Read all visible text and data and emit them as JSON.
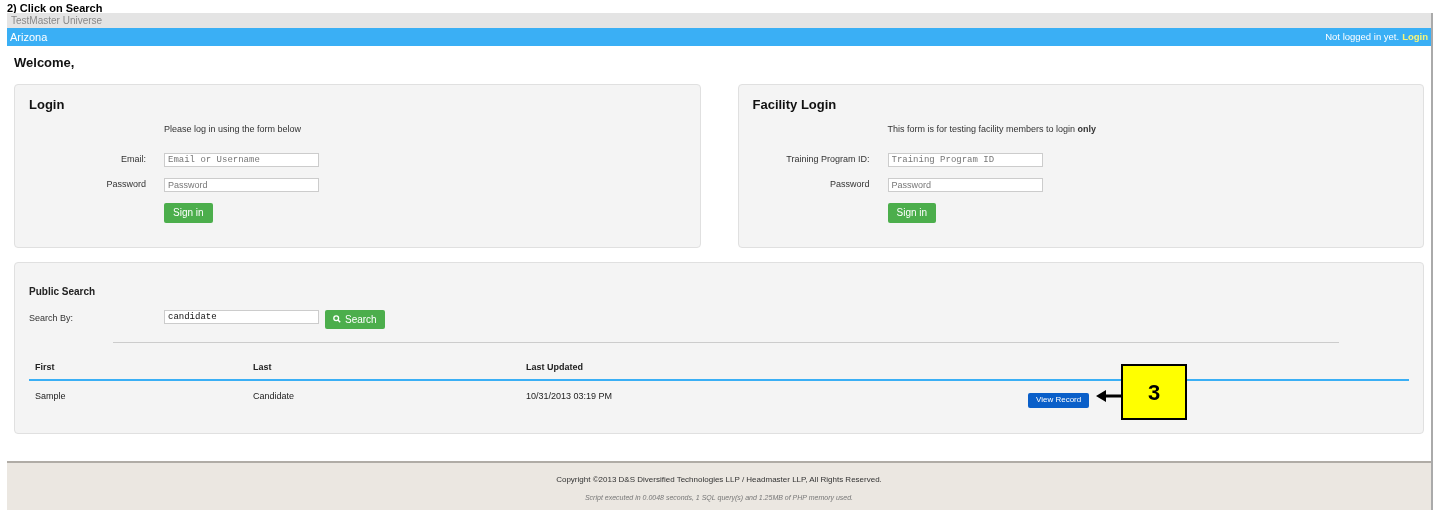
{
  "caption": "2) Click on Search",
  "header": {
    "brand": "TestMaster Universe",
    "state": "Arizona",
    "login_status": "Not logged in yet.",
    "login_link": "Login"
  },
  "welcome": "Welcome,",
  "login": {
    "title": "Login",
    "note": "Please log in using the form below",
    "fields": [
      {
        "label": "Email:",
        "placeholder": "Email or Username",
        "kind": "mono"
      },
      {
        "label": "Password",
        "placeholder": "Password",
        "kind": "sans"
      }
    ],
    "button": "Sign in"
  },
  "facility_login": {
    "title": "Facility Login",
    "note": "This form is for testing facility members to login **only**",
    "fields": [
      {
        "label": "Training Program ID:",
        "placeholder": "Training Program ID",
        "kind": "mono"
      },
      {
        "label": "Password",
        "placeholder": "Password",
        "kind": "sans"
      }
    ],
    "button": "Sign in"
  },
  "public_search": {
    "title": "Public Search",
    "label": "Search By:",
    "value": "candidate",
    "button": "Search",
    "table": {
      "columns": [
        "First",
        "Last",
        "Last Updated"
      ],
      "rows": [
        {
          "cells": [
            "Sample",
            "Candidate",
            "10/31/2013 03:19 PM"
          ],
          "action": "View Record"
        }
      ]
    }
  },
  "callout": {
    "label": "3"
  },
  "footer": {
    "copyright": "Copyright ©2013 D&S Diversified Technologies LLP / Headmaster LLP, All Rights Reserved.",
    "stats": "Script executed in 0.0048 seconds, 1 SQL query(s) and 1.25MB of PHP memory used."
  }
}
